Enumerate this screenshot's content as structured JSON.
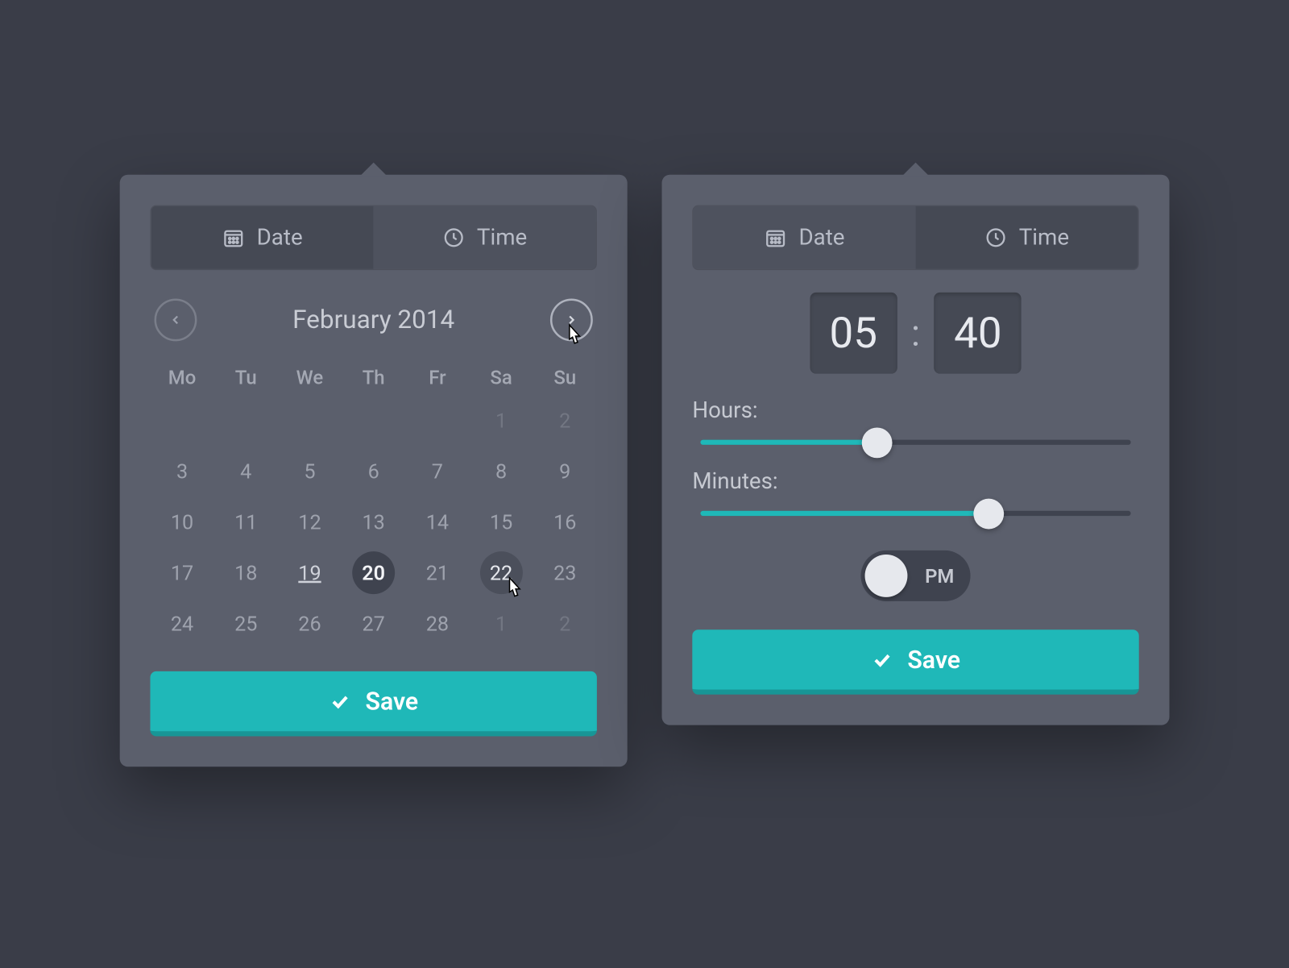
{
  "tabs": {
    "date": "Date",
    "time": "Time"
  },
  "calendar": {
    "month_label": "February 2014",
    "weekdays": [
      "Mo",
      "Tu",
      "We",
      "Th",
      "Fr",
      "Sa",
      "Su"
    ],
    "cells": [
      {
        "n": "",
        "other": true
      },
      {
        "n": "",
        "other": true
      },
      {
        "n": "",
        "other": true
      },
      {
        "n": "",
        "other": true
      },
      {
        "n": "",
        "other": true
      },
      {
        "n": "1",
        "other": true
      },
      {
        "n": "2",
        "other": true
      },
      {
        "n": "3"
      },
      {
        "n": "4"
      },
      {
        "n": "5"
      },
      {
        "n": "6"
      },
      {
        "n": "7"
      },
      {
        "n": "8"
      },
      {
        "n": "9"
      },
      {
        "n": "10"
      },
      {
        "n": "11"
      },
      {
        "n": "12"
      },
      {
        "n": "13"
      },
      {
        "n": "14"
      },
      {
        "n": "15"
      },
      {
        "n": "16"
      },
      {
        "n": "17"
      },
      {
        "n": "18"
      },
      {
        "n": "19",
        "today": true
      },
      {
        "n": "20",
        "sel": true
      },
      {
        "n": "21"
      },
      {
        "n": "22",
        "hov": true
      },
      {
        "n": "23"
      },
      {
        "n": "24"
      },
      {
        "n": "25"
      },
      {
        "n": "26"
      },
      {
        "n": "27"
      },
      {
        "n": "28"
      },
      {
        "n": "1",
        "other": true
      },
      {
        "n": "2",
        "other": true
      }
    ]
  },
  "time": {
    "hours_value": "05",
    "minutes_value": "40",
    "hours_label": "Hours:",
    "minutes_label": "Minutes:",
    "hours_pct": 41,
    "minutes_pct": 67,
    "period": "PM"
  },
  "save_label": "Save"
}
